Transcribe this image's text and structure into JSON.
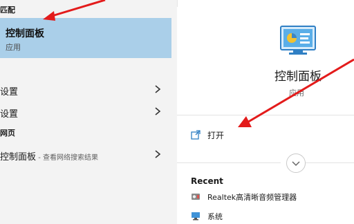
{
  "results": {
    "best_match_header": "匹配",
    "best_match": {
      "title": "控制面板",
      "subtitle": "应用"
    },
    "settings_items": [
      {
        "label": "设置"
      },
      {
        "label": "设置"
      }
    ],
    "web_header": "网页",
    "web_item": {
      "label": "控制面板",
      "hint": " - 查看网络搜索结果"
    }
  },
  "preview": {
    "app_title": "控制面板",
    "app_type": "应用",
    "open_label": "打开",
    "recent_header": "Recent",
    "recent_items": [
      {
        "label": "Realtek高清晰音频管理器",
        "icon": "speaker-icon"
      },
      {
        "label": "系统",
        "icon": "system-icon"
      }
    ]
  },
  "colors": {
    "selection": "#aacfe9",
    "left_bg": "#f3f3f3",
    "annotation": "#e31b1b"
  }
}
